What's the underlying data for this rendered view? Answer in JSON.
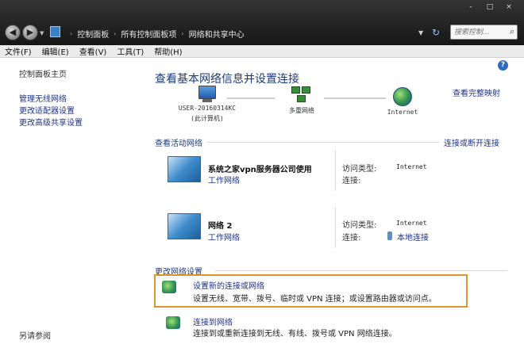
{
  "window": {
    "controls": [
      "-",
      "□",
      "×"
    ]
  },
  "nav": {
    "back_glyph": "◀",
    "forward_glyph": "▶",
    "breadcrumb": [
      "控制面板",
      "所有控制面板项",
      "网络和共享中心"
    ],
    "separator": "›",
    "search_placeholder": "搜索控制..."
  },
  "icons": {
    "back": "back-arrow-icon",
    "forward": "forward-arrow-icon",
    "address": "control-panel-icon",
    "refresh": "refresh-icon",
    "search": "search-icon",
    "help": "help-icon",
    "help_glyph": "?",
    "search_glyph": "⌕",
    "refresh_glyph": "↻"
  },
  "menu": [
    "文件(F)",
    "编辑(E)",
    "查看(V)",
    "工具(T)",
    "帮助(H)"
  ],
  "sidebar": {
    "home": "控制面板主页",
    "links": [
      "管理无线网络",
      "更改适配器设置",
      "更改高级共享设置"
    ],
    "see_also": "另请参阅"
  },
  "main": {
    "title": "查看基本网络信息并设置连接",
    "full_map_link": "查看完整映射",
    "map": {
      "computer_name": "USER-20160314KC",
      "computer_sub": "(此计算机)",
      "middle": "多重网络",
      "internet": "Internet"
    },
    "active_section": "查看活动网络",
    "disconnect_link": "连接或断开连接",
    "networks": [
      {
        "name": "系统之家vpn服务器公司使用",
        "type": "工作网络",
        "access_label": "访问类型:",
        "access_value": "Internet",
        "conn_label": "连接:",
        "conn_value": ""
      },
      {
        "name": "网络  2",
        "type": "工作网络",
        "access_label": "访问类型:",
        "access_value": "Internet",
        "conn_label": "连接:",
        "conn_value": "本地连接"
      }
    ],
    "change_section": "更改网络设置",
    "tasks": [
      {
        "link": "设置新的连接或网络",
        "desc": "设置无线、宽带、拨号、临时或 VPN 连接；或设置路由器或访问点。"
      },
      {
        "link": "连接到网络",
        "desc": "连接到或重新连接到无线、有线、拨号或 VPN 网络连接。"
      }
    ]
  },
  "colors": {
    "titlebar": "#1e1e1e",
    "link": "#1e3287",
    "heading": "#1c3a7a",
    "highlight_border": "#e0942e"
  }
}
